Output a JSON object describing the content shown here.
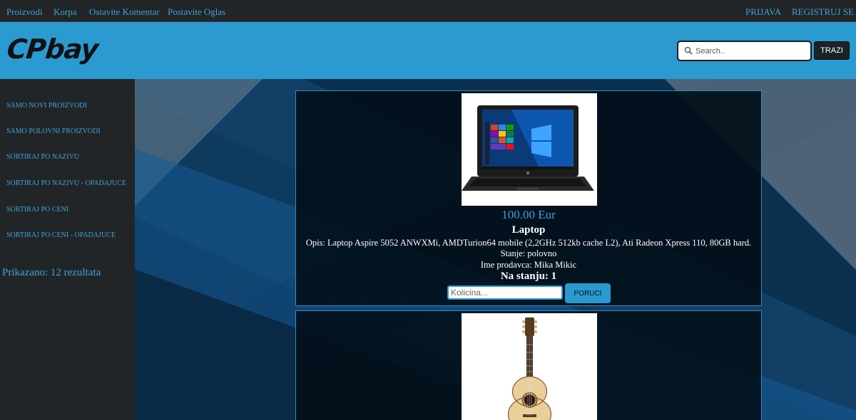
{
  "topnav": {
    "left": [
      "Proizvodi",
      "Korpa",
      "Ostavite Komentar",
      "Postavite Oglas"
    ],
    "login": "PRIJAVA",
    "register": "REGISTRUJ SE"
  },
  "header": {
    "logo": "CPbay",
    "search_placeholder": "Search..",
    "search_button": "TRAZI"
  },
  "sidebar": {
    "items": [
      "SAMO NOVI PROIZVODI",
      "SAMO POLOVNI PROIZVODI",
      "SORTIRAJ PO NAZIVU",
      "SORTIRAJ PO NAZIVU - OPADAJUCE",
      "SORTIRAJ PO CENI",
      "SORTIRAJ PO CENI - OPADAJUCE"
    ],
    "result_count": "Prikazano: 12 rezultata"
  },
  "products": [
    {
      "price": "100.00 Eur",
      "name": "Laptop",
      "description": "Opis: Laptop Aspire 5052 ANWXMi, AMDTurion64 mobile (2,2GHz 512kb cache L2), Ati Radeon Xpress 110, 80GB hard.",
      "condition": "Stanje: polovno",
      "seller": "Ime prodavca: Mika Mikic",
      "stock": "Na stanju: 1",
      "qty_placeholder": "Kolicina...",
      "order_button": "PORUCI",
      "image": "laptop-photo"
    },
    {
      "image": "guitar-photo"
    }
  ],
  "colors": {
    "accent": "#2a9ad0",
    "link": "#3ea3d8",
    "nav_bg": "#222527"
  }
}
